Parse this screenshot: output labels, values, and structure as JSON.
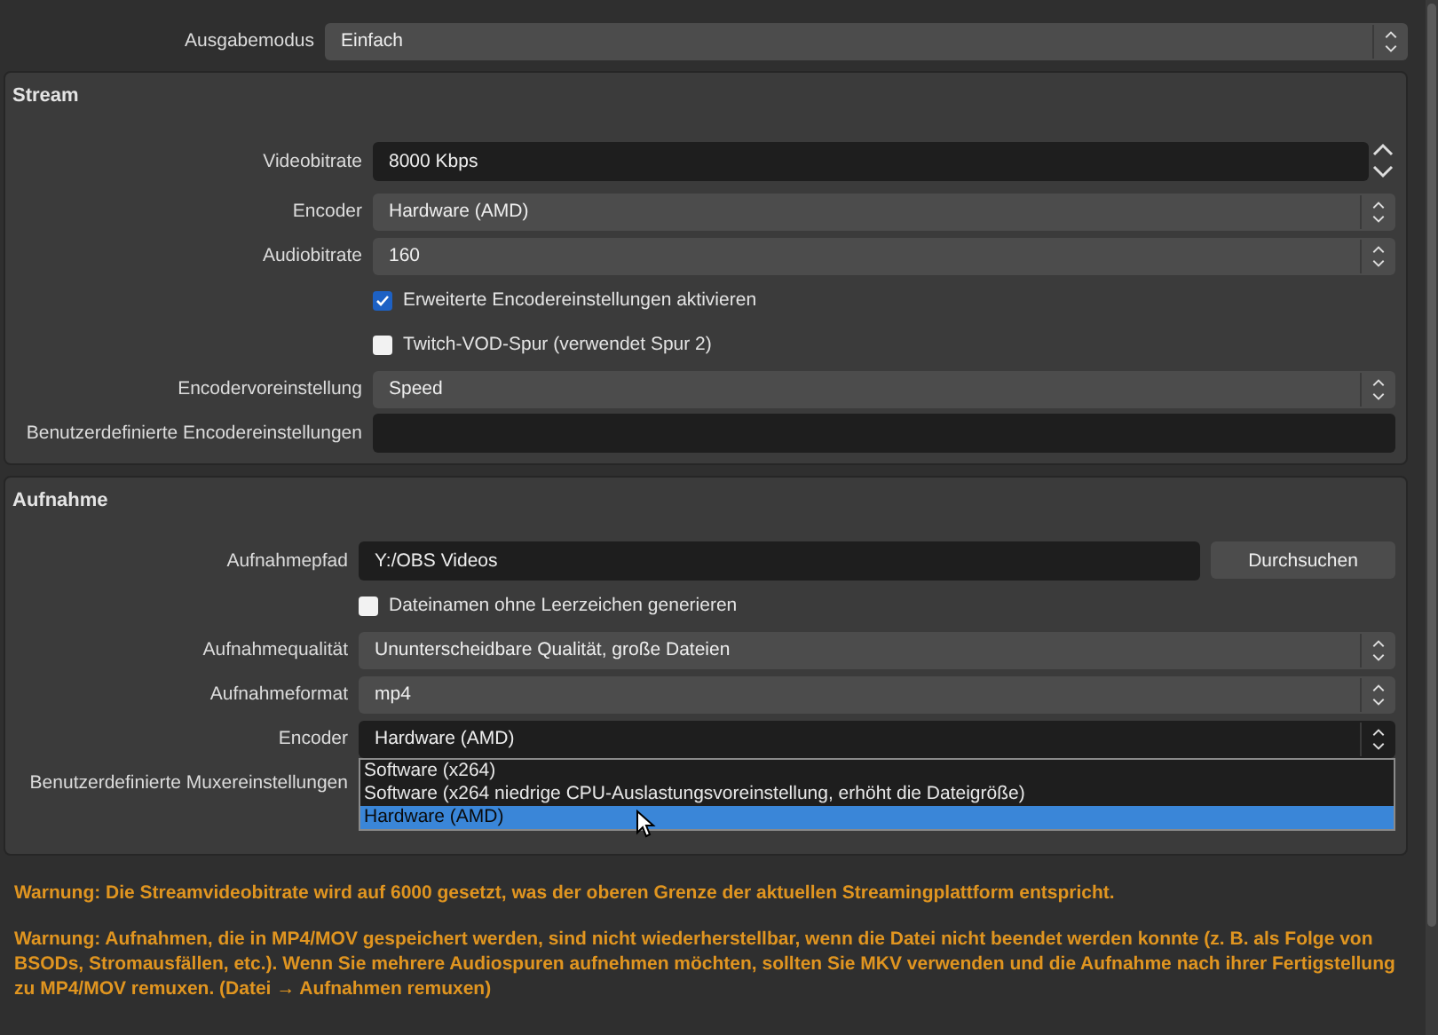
{
  "output_mode": {
    "label": "Ausgabemodus",
    "value": "Einfach"
  },
  "stream": {
    "title": "Stream",
    "rows": [
      {
        "kind": "spin",
        "label": "Videobitrate",
        "value": "8000 Kbps"
      },
      {
        "kind": "combo",
        "label": "Encoder",
        "value": "Hardware (AMD)"
      },
      {
        "kind": "combo",
        "label": "Audiobitrate",
        "value": "160"
      },
      {
        "kind": "check",
        "label": "Erweiterte Encodereinstellungen aktivieren",
        "checked": true
      },
      {
        "kind": "check",
        "label": "Twitch-VOD-Spur (verwendet Spur 2)",
        "checked": false
      },
      {
        "kind": "combo",
        "label": "Encodervoreinstellung",
        "value": "Speed"
      },
      {
        "kind": "text",
        "label": "Benutzerdefinierte Encodereinstellungen"
      }
    ]
  },
  "recording": {
    "title": "Aufnahme",
    "rows": [
      {
        "kind": "path",
        "label": "Aufnahmepfad",
        "value": "Y:/OBS Videos",
        "button": "Durchsuchen"
      },
      {
        "kind": "check",
        "label": "Dateinamen ohne Leerzeichen generieren",
        "checked": false
      },
      {
        "kind": "combo",
        "label": "Aufnahmequalität",
        "value": "Ununterscheidbare Qualität, große Dateien"
      },
      {
        "kind": "combo",
        "label": "Aufnahmeformat",
        "value": "mp4"
      },
      {
        "kind": "combo",
        "label": "Encoder",
        "value": "Hardware (AMD)",
        "open": true,
        "options": [
          {
            "label": "Software (x264)",
            "selected": false
          },
          {
            "label": "Software (x264 niedrige CPU-Auslastungsvoreinstellung, erhöht die Dateigröße)",
            "selected": false
          },
          {
            "label": "Hardware (AMD)",
            "selected": true
          }
        ]
      },
      {
        "kind": "label",
        "label": "Benutzerdefinierte Muxereinstellungen"
      }
    ]
  },
  "warnings": [
    "Warnung: Die Streamvideobitrate wird auf 6000 gesetzt, was der oberen Grenze der aktuellen Streamingplattform entspricht.",
    "Warnung: Aufnahmen, die in MP4/MOV gespeichert werden, sind nicht wiederherstellbar, wenn die Datei nicht beendet werden konnte (z. B. als Folge von BSODs, Stromausfällen, etc.). Wenn Sie mehrere Audiospuren aufnehmen möchten, sollten Sie MKV verwenden und die Aufnahme nach ihrer Fertigstellung zu MP4/MOV remuxen. (Datei → Aufnahmen remuxen)"
  ]
}
